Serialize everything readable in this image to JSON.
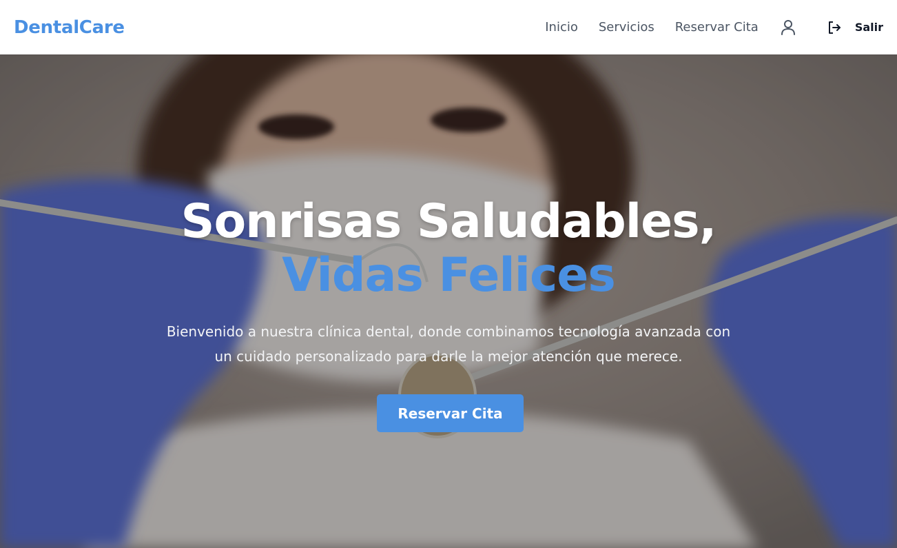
{
  "header": {
    "logo": "DentalCare",
    "nav": {
      "inicio": "Inicio",
      "servicios": "Servicios",
      "reservar": "Reservar Cita"
    },
    "user_icon": "user-icon",
    "logout_icon": "logout-icon",
    "logout_label": "Salir"
  },
  "hero": {
    "title_line1": "Sonrisas Saludables,",
    "title_line2": "Vidas Felices",
    "subtitle": "Bienvenido a nuestra clínica dental, donde combinamos tecnología avanzada con un cuidado personalizado para darle la mejor atención que merece.",
    "cta_label": "Reservar Cita",
    "background_image": "dentist holding dental mirror and probe with blue gloves"
  },
  "colors": {
    "accent": "#4a90e2",
    "nav_text": "#4b5563",
    "header_bg": "#ffffff"
  }
}
